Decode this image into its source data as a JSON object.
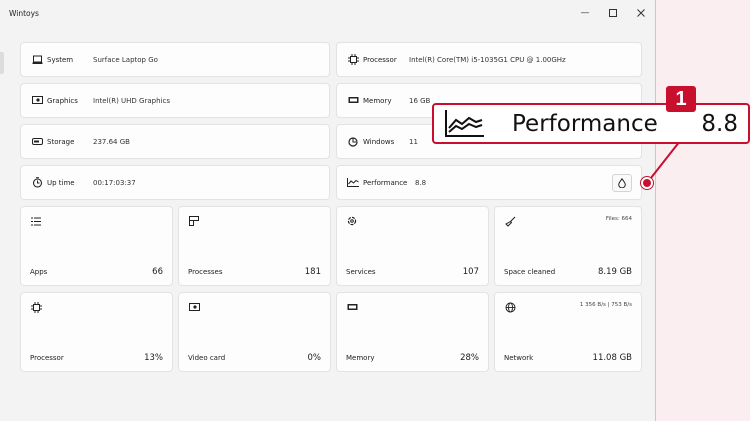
{
  "window": {
    "title": "Wintoys"
  },
  "info": {
    "system": {
      "label": "System",
      "value": "Surface Laptop Go",
      "icon": "laptop-icon"
    },
    "processor": {
      "label": "Processor",
      "value": "Intel(R) Core(TM) i5-1035G1 CPU @ 1.00GHz",
      "icon": "cpu-icon"
    },
    "graphics": {
      "label": "Graphics",
      "value": "Intel(R) UHD Graphics",
      "icon": "graphics-card-icon"
    },
    "memory": {
      "label": "Memory",
      "value": "16 GB",
      "icon": "memory-icon"
    },
    "storage": {
      "label": "Storage",
      "value": "237.64 GB",
      "icon": "drive-icon"
    },
    "windows": {
      "label": "Windows",
      "value": "11",
      "icon": "windows-icon"
    },
    "uptime": {
      "label": "Up time",
      "value": "00:17:03:37",
      "icon": "stopwatch-icon"
    },
    "performance": {
      "label": "Performance",
      "value": "8.8",
      "icon": "performance-chart-icon"
    }
  },
  "tiles": {
    "apps": {
      "label": "Apps",
      "value": "66",
      "icon": "apps-list-icon"
    },
    "processes": {
      "label": "Processes",
      "value": "181",
      "icon": "processes-icon"
    },
    "services": {
      "label": "Services",
      "value": "107",
      "icon": "gear-icon"
    },
    "space": {
      "label": "Space cleaned",
      "value": "8.19 GB",
      "topright": "Files: 664",
      "icon": "broom-icon"
    },
    "cpu": {
      "label": "Processor",
      "value": "13%",
      "icon": "cpu-icon"
    },
    "gpu": {
      "label": "Video card",
      "value": "0%",
      "icon": "graphics-card-icon"
    },
    "ram": {
      "label": "Memory",
      "value": "28%",
      "icon": "memory-icon"
    },
    "network": {
      "label": "Network",
      "value": "11.08 GB",
      "topright": "1 356 B/s | 753 B/s",
      "icon": "globe-icon"
    }
  },
  "callout": {
    "badge": "1",
    "label": "Performance",
    "value": "8.8"
  },
  "colors": {
    "accent": "#c8102e",
    "background": "#f3f3f3",
    "card": "#fdfdfd"
  }
}
